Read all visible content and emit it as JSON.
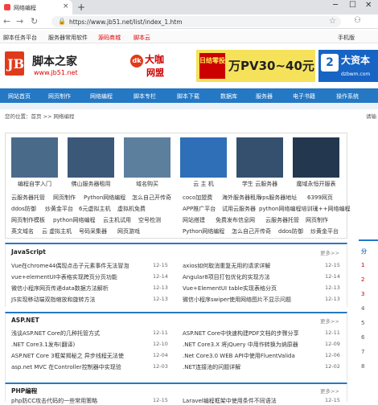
{
  "browser": {
    "tab_title": "网络编程",
    "url": "https://www.jb51.net/list/index_1.htm"
  },
  "topbar": {
    "items": [
      "脚本任务平台",
      "服务器常用软件",
      "源码商城",
      "脚本云"
    ],
    "mobile": "手机版"
  },
  "banner": {
    "logo_text": "JB",
    "site_name": "脚本之家",
    "site_url": "www.jb51.net",
    "ad1_line1": "大咖",
    "ad1_line2": "网盟",
    "ad1_mark": "dk",
    "ad2_badge": "日结零投",
    "ad2_text": "万PV30~40元",
    "ad3_text": "大资本",
    "ad3_url": "dzbwm.com"
  },
  "nav": {
    "items": [
      "网站首页",
      "网页制作",
      "网络编程",
      "脚本专栏",
      "脚本下载",
      "数据库",
      "服务器",
      "电子书籍",
      "操作系统"
    ]
  },
  "breadcrumb": {
    "text": "您的位置：首页 >> 网络编程",
    "right": "请输"
  },
  "gallery": {
    "captions": [
      "编程自学入门",
      "佛山服务器租用",
      "域名购买",
      "云 主 机",
      "学生 云服务器",
      "魔域永恒开服表"
    ]
  },
  "links": {
    "row1": [
      "云服务器托管",
      "网页制作",
      "Python网络编程",
      "怎么自己开传奇",
      "coco加盟费",
      "海外服务器租用",
      "vps服务器地址",
      "6399网页"
    ],
    "row2": [
      "ddos防御",
      "炒黄金平台",
      "6元虚拟主机",
      "虚拟机免费",
      "APP推广平台",
      "试用云服务器",
      "python网络编程培训班",
      "c++网络编程"
    ],
    "row3": [
      "网页制作模板",
      "python网络编程",
      "云主机试用",
      "空号检测",
      "网站搭建",
      "免费发布信息网",
      "云服务器托管",
      "网页制作"
    ],
    "row4": [
      "英文域名",
      "云 虚拟主机",
      "号码采集器",
      "网页游戏",
      "Python网络编程",
      "怎么自己开传奇",
      "ddos防御",
      "炒黄金平台"
    ]
  },
  "sections": [
    {
      "title": "JavaScript",
      "more": "更多>>",
      "left": [
        {
          "t": "Vue在chrome44偶现点击子元素事件无法冒泡",
          "d": "12-15"
        },
        {
          "t": "vue+elementUI中表格实现跨页分页功能",
          "d": "12-14"
        },
        {
          "t": "微信小程序网页传递data数据方法解析",
          "d": "12-13"
        },
        {
          "t": "JS实现移动端双指缩放和旋转方法",
          "d": "12-13"
        }
      ],
      "right": [
        {
          "t": "axios如何取消重复无用的请求详解",
          "d": "12-15"
        },
        {
          "t": "Angular8项目打包优化的实现方法",
          "d": "12-14"
        },
        {
          "t": "Vue+ElementUI table实现表格分页",
          "d": "12-13"
        },
        {
          "t": "微信小程序swiper使用网络图片不显示问题",
          "d": "12-13"
        }
      ]
    },
    {
      "title": "ASP.NET",
      "more": "更多>>",
      "left": [
        {
          "t": "浅谈ASP.NET Core的几种托管方式",
          "d": "12-11"
        },
        {
          "t": ".NET Core3.1发布(翻译)",
          "d": "12-10"
        },
        {
          "t": "ASP.NET Core 3框架揭秘之 异步线程无法使",
          "d": "12-04"
        },
        {
          "t": "asp.net MVC 在Controller控制器中实现验",
          "d": "12-03"
        }
      ],
      "right": [
        {
          "t": "ASP.NET Core中快速构建PDF文档的步骤分享",
          "d": "12-11"
        },
        {
          "t": ".NET Core3.X 将jQuery 中用作转换为纳原器",
          "d": "12-09"
        },
        {
          "t": ".Net Core3.0 WEB API中使用FluentValida",
          "d": "12-06"
        },
        {
          "t": ".NET连接池的问题详解",
          "d": "12-02"
        }
      ]
    },
    {
      "title": "PHP编程",
      "more": "更多>>",
      "left": [
        {
          "t": "php防CC攻击代码的一些常用策略",
          "d": "12-15"
        }
      ],
      "right": [
        {
          "t": "Laravel编程框架中使用条件不同语法",
          "d": "12-15"
        }
      ]
    }
  ],
  "side": {
    "label": "分",
    "nums": [
      "1",
      "2",
      "3",
      "4",
      "5",
      "6",
      "7",
      "8"
    ]
  }
}
